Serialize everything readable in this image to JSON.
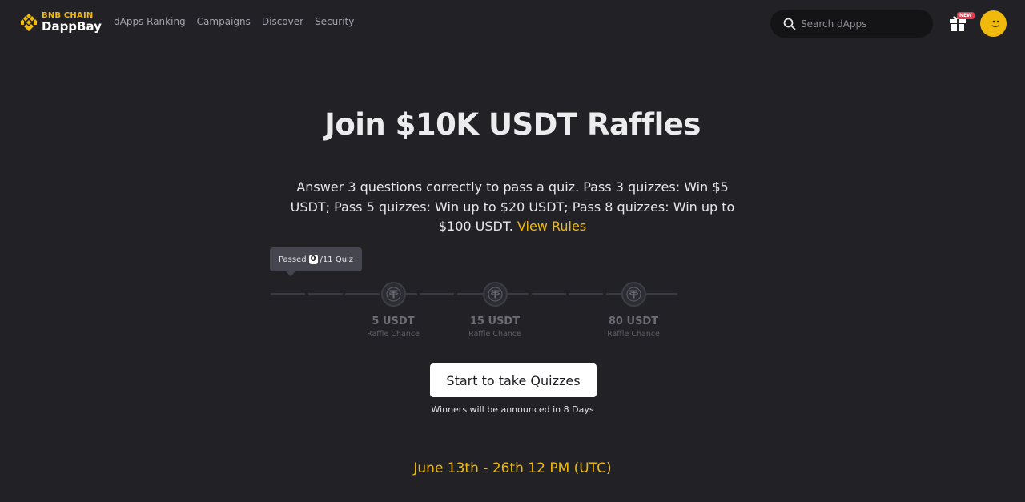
{
  "header": {
    "logo_small": "BNB CHAIN",
    "logo_big": "DappBay",
    "nav": [
      "dApps Ranking",
      "Campaigns",
      "Discover",
      "Security"
    ],
    "search_placeholder": "Search dApps",
    "gift_badge": "NEW"
  },
  "hero": {
    "title": "Join $10K USDT Raffles",
    "description": "Answer 3 questions correctly to pass a quiz. Pass 3 quizzes: Win $5 USDT; Pass 5 quizzes: Win up to $20 USDT; Pass 8 quizzes: Win up to $100 USDT.",
    "rules_link": "View Rules"
  },
  "progress": {
    "passed_label": "Passed",
    "passed_count": "0",
    "total_label": "/11 Quiz",
    "passed_value": 0,
    "total_quizzes": 11,
    "milestones": [
      {
        "amount": "5 USDT",
        "label": "Raffle Chance",
        "quiz": 3
      },
      {
        "amount": "15 USDT",
        "label": "Raffle Chance",
        "quiz": 5
      },
      {
        "amount": "80 USDT",
        "label": "Raffle Chance",
        "quiz": 8
      }
    ]
  },
  "cta_label": "Start to take Quizzes",
  "winners_note": "Winners will be announced in 8 Days",
  "dates": "June 13th - 26th 12 PM (UTC)",
  "colors": {
    "accent": "#F0B90B",
    "background": "#222226"
  }
}
